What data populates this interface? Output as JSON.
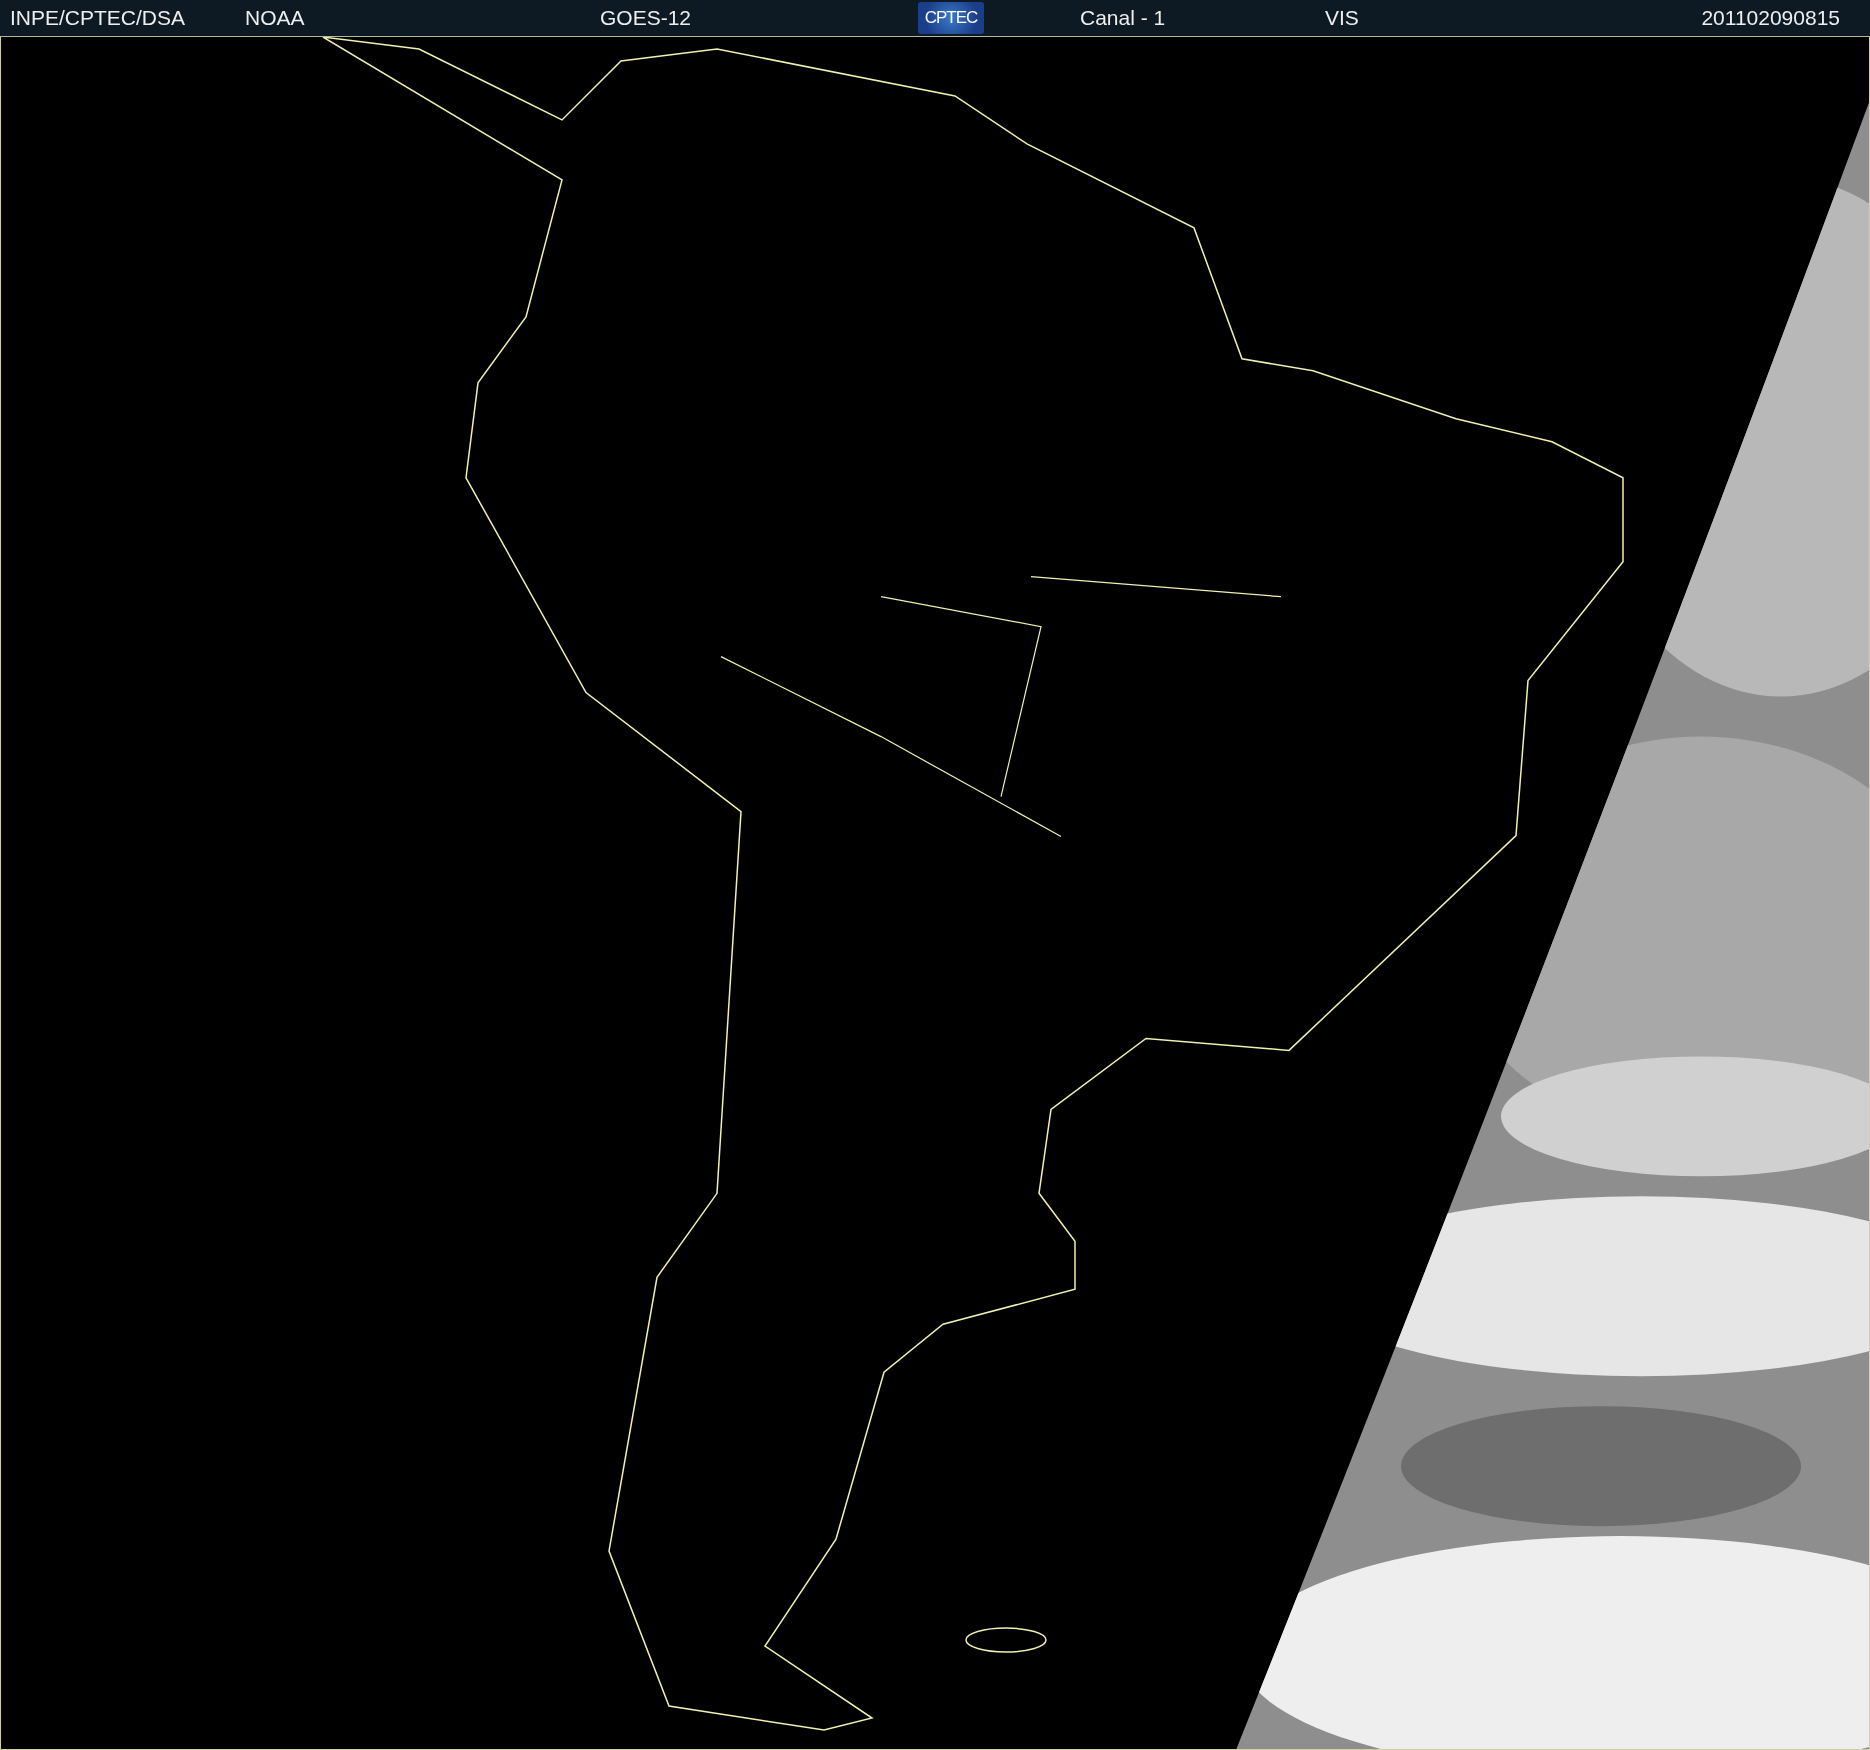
{
  "header": {
    "source": "INPE/CPTEC/DSA",
    "agency": "NOAA",
    "satellite": "GOES-12",
    "logo_text": "CPTEC",
    "channel": "Canal - 1",
    "band": "VIS",
    "timestamp": "201102090815"
  }
}
